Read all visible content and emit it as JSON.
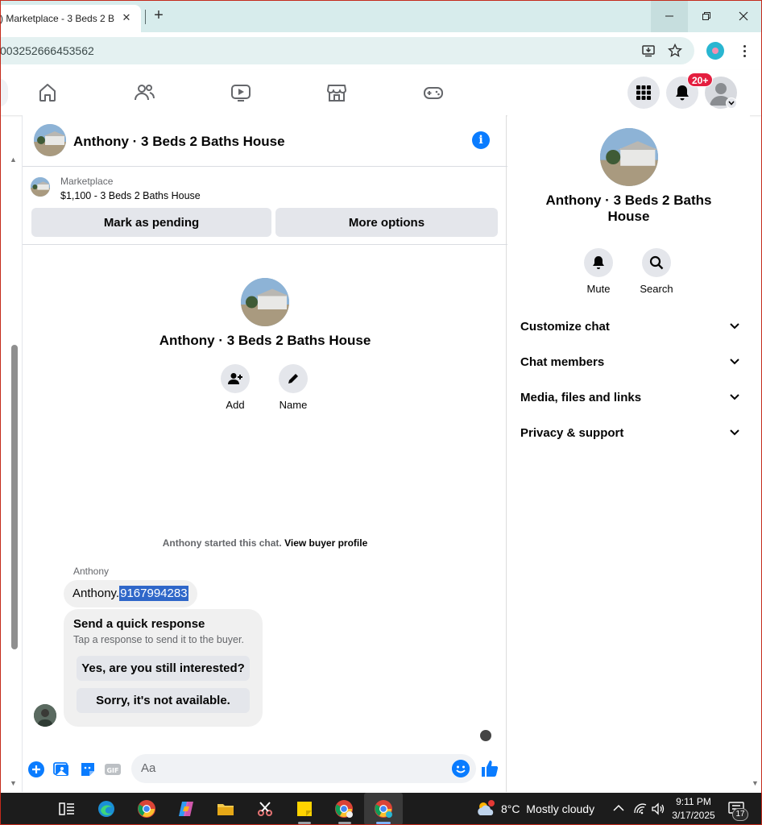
{
  "browser": {
    "tab_title": ") Marketplace - 3 Beds 2 Bo",
    "url": "003252666453562"
  },
  "fb_nav": {
    "notification_count": "20+"
  },
  "chat": {
    "title": "Anthony · 3 Beds 2 Baths House",
    "marketplace": {
      "label": "Marketplace",
      "listing": "$1,100 - 3 Beds 2 Baths House",
      "mark_pending_label": "Mark as pending",
      "more_options_label": "More options"
    },
    "center_title": "Anthony · 3 Beds 2 Baths House",
    "actions": {
      "add_label": "Add",
      "name_label": "Name"
    },
    "started_text": "Anthony started this chat. ",
    "buyer_profile_link": "View buyer profile",
    "sender_name": "Anthony",
    "message_prefix": "Anthony.",
    "message_selected": "9167994283",
    "quick_response": {
      "title": "Send a quick response",
      "subtitle": "Tap a response to send it to the buyer.",
      "options": [
        "Yes, are you still interested?",
        "Sorry, it's not available."
      ]
    },
    "composer_placeholder": "Aa"
  },
  "info_panel": {
    "title": "Anthony · 3 Beds 2 Baths House",
    "mute_label": "Mute",
    "search_label": "Search",
    "sections": [
      "Customize chat",
      "Chat members",
      "Media, files and links",
      "Privacy & support"
    ]
  },
  "taskbar": {
    "temperature": "8°C",
    "weather": "Mostly cloudy",
    "time": "9:11 PM",
    "date": "3/17/2025",
    "notif_count": "17"
  },
  "colors": {
    "accent": "#0a7cff",
    "badge": "#e41e3f",
    "selection": "#2f67c9"
  }
}
